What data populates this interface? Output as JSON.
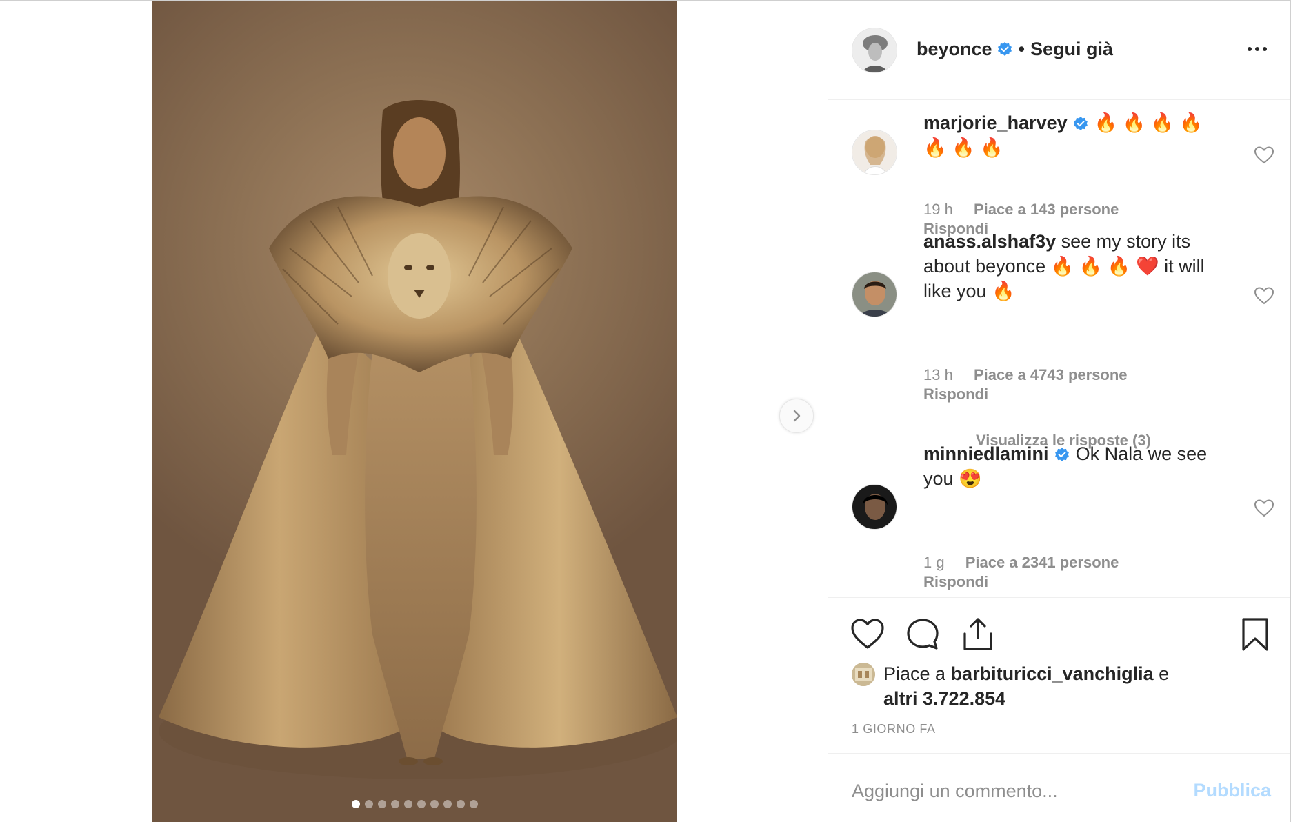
{
  "post": {
    "carousel": {
      "total_images": 10,
      "active_index": 0
    }
  },
  "header": {
    "username": "beyonce",
    "separator": "•",
    "follow_state": "Segui già"
  },
  "comments": [
    {
      "username": "marjorie_harvey",
      "verified": true,
      "text": "🔥 🔥 🔥 🔥 🔥 🔥 🔥",
      "time": "19 h",
      "likes": "Piace a 143 persone",
      "reply": "Rispondi"
    },
    {
      "username": "anass.alshaf3y",
      "verified": false,
      "text": "see my story its about beyonce 🔥 🔥 🔥 ❤️  it will like you 🔥",
      "time": "13 h",
      "likes": "Piace a 4743 persone",
      "reply": "Rispondi",
      "view_replies": "Visualizza le risposte (3)"
    },
    {
      "username": "minniedlamini",
      "verified": true,
      "text": "Ok Nala we see you 😍",
      "time": "1 g",
      "likes": "Piace a 2341 persone",
      "reply": "Rispondi"
    }
  ],
  "likes_summary": {
    "prefix": "Piace a ",
    "liker": "barbituricci_vanchiglia",
    "suffix_word": " e",
    "others": "altri 3.722.854"
  },
  "timestamp": "1 GIORNO FA",
  "add_comment": {
    "placeholder": "Aggiungi un commento...",
    "publish_label": "Pubblica"
  },
  "colors": {
    "verified": "#3897f0",
    "publish_disabled": "#b3dbff",
    "muted_text": "#8e8e8e"
  }
}
